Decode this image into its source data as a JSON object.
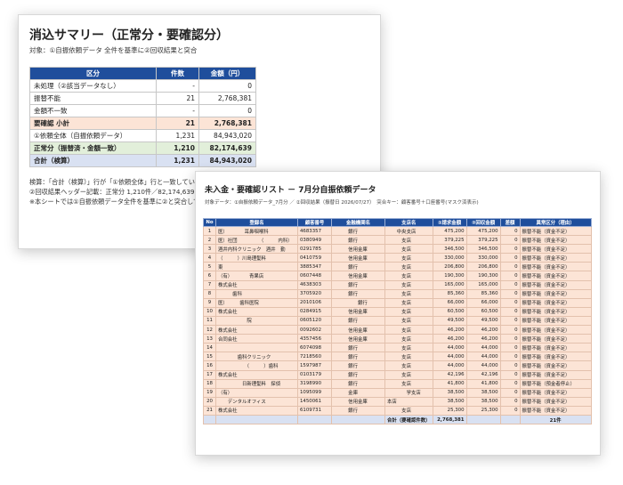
{
  "summary": {
    "title": "消込サマリー（正常分・要確認分）",
    "subtitle": "対象：①自振依頼データ 全件を基準に②回収結果と突合",
    "headers": [
      "区分",
      "件数",
      "金額（円）"
    ],
    "rows": [
      {
        "label": "未処理（②該当データなし）",
        "count": "-",
        "amount": "0"
      },
      {
        "label": "振替不能",
        "count": "21",
        "amount": "2,768,381"
      },
      {
        "label": "金額不一致",
        "count": "-",
        "amount": "0"
      },
      {
        "label": "要確認 小計",
        "count": "21",
        "amount": "2,768,381"
      },
      {
        "label": "①依頼全体（自振依頼データ）",
        "count": "1,231",
        "amount": "84,943,020"
      },
      {
        "label": "正常分（振替済・金額一致）",
        "count": "1,210",
        "amount": "82,174,639"
      },
      {
        "label": "合計（検算）",
        "count": "1,231",
        "amount": "84,943,020"
      }
    ],
    "notes": [
      "検算：「合計（検算）」行が「①依頼全体」行と一致してい",
      "②回収結果ヘッダー記載：正常分 1,210件／82,174,639円",
      "※本シートでは①自振依頼データ全件を基準に②と突合して"
    ]
  },
  "detail": {
    "title": "未入金・要確認リスト － 7月分自振依頼データ",
    "subtitle": "対象データ：①自振依頼データ_7月分 ／ ②回収結果（振替日 2026/07/27）　突合キー：顧客番号＋口座番号(マスク済表示)",
    "headers": [
      "No",
      "登録名",
      "顧客番号",
      "金融機関名",
      "支店名",
      "①請求金額",
      "②回収金額",
      "差額",
      "異常区分（理由）"
    ],
    "rows": [
      {
        "no": "1",
        "name": "医）　　　　耳鼻咽喉科",
        "cust": "4683357",
        "bank": "　　　銀行",
        "branch": "　　中央支店",
        "req": "475,200",
        "rec": "475,200",
        "diff": "0",
        "reason": "振替不能（資金不足）"
      },
      {
        "no": "2",
        "name": "医）社団　　　　　（　　　内科）",
        "cust": "0380949",
        "bank": "　　　銀行",
        "branch": "　　　支店",
        "req": "379,225",
        "rec": "379,225",
        "diff": "0",
        "reason": "振替不能（資金不足）"
      },
      {
        "no": "3",
        "name": "酒井内科クリニック　酒井　勤",
        "cust": "0291785",
        "bank": "　　　信用金庫",
        "branch": "　　　支店",
        "req": "346,500",
        "rec": "346,500",
        "diff": "0",
        "reason": "振替不能（資金不足）"
      },
      {
        "no": "4",
        "name": "（　　　）川島理髪料",
        "cust": "0410759",
        "bank": "　　　信用金庫",
        "branch": "　　　支店",
        "req": "330,000",
        "rec": "330,000",
        "diff": "0",
        "reason": "振替不能（資金不足）"
      },
      {
        "no": "5",
        "name": "東　　　　",
        "cust": "3885347",
        "bank": "　　　銀行",
        "branch": "　　　支店",
        "req": "206,800",
        "rec": "206,800",
        "diff": "0",
        "reason": "振替不能（資金不足）"
      },
      {
        "no": "6",
        "name": "（有）　　　　青果店",
        "cust": "0607448",
        "bank": "　　　信用金庫",
        "branch": "　　　支店",
        "req": "190,300",
        "rec": "190,300",
        "diff": "0",
        "reason": "振替不能（資金不足）"
      },
      {
        "no": "7",
        "name": "株式会社　　　　",
        "cust": "4638303",
        "bank": "　　　銀行",
        "branch": "　　　支店",
        "req": "165,000",
        "rec": "165,000",
        "diff": "0",
        "reason": "振替不能（資金不足）"
      },
      {
        "no": "8",
        "name": "　　　歯科",
        "cust": "3705920",
        "bank": "　　　銀行",
        "branch": "　　　支店",
        "req": "85,360",
        "rec": "85,360",
        "diff": "0",
        "reason": "振替不能（資金不足）"
      },
      {
        "no": "9",
        "name": "医）　　　歯科医院",
        "cust": "2010106",
        "bank": "　　　　　銀行",
        "branch": "　　　支店",
        "req": "66,000",
        "rec": "66,000",
        "diff": "0",
        "reason": "振替不能（資金不足）"
      },
      {
        "no": "10",
        "name": "株式会社　　　　",
        "cust": "0284915",
        "bank": "　　　信用金庫",
        "branch": "　　　支店",
        "req": "60,500",
        "rec": "60,500",
        "diff": "0",
        "reason": "振替不能（資金不足）"
      },
      {
        "no": "11",
        "name": "　　　　　　院",
        "cust": "0605120",
        "bank": "　　　銀行",
        "branch": "　　　支店",
        "req": "49,500",
        "rec": "49,500",
        "diff": "0",
        "reason": "振替不能（資金不足）"
      },
      {
        "no": "12",
        "name": "株式会社　　　　　",
        "cust": "0092602",
        "bank": "　　　信用金庫",
        "branch": "　　　支店",
        "req": "46,200",
        "rec": "46,200",
        "diff": "0",
        "reason": "振替不能（資金不足）"
      },
      {
        "no": "13",
        "name": "合同会社　　　　",
        "cust": "4357456",
        "bank": "　　　信用金庫",
        "branch": "　　　支店",
        "req": "46,200",
        "rec": "46,200",
        "diff": "0",
        "reason": "振替不能（資金不足）"
      },
      {
        "no": "14",
        "name": "　　　　　　",
        "cust": "6074098",
        "bank": "　　　銀行",
        "branch": "　　　支店",
        "req": "44,000",
        "rec": "44,000",
        "diff": "0",
        "reason": "振替不能（資金不足）"
      },
      {
        "no": "15",
        "name": "　　　　歯科クリニック",
        "cust": "7218560",
        "bank": "　　　銀行",
        "branch": "　　　支店",
        "req": "44,000",
        "rec": "44,000",
        "diff": "0",
        "reason": "振替不能（資金不足）"
      },
      {
        "no": "16",
        "name": "　　　　　　（　　　）歯科",
        "cust": "1597987",
        "bank": "　　　銀行",
        "branch": "　　　支店",
        "req": "44,000",
        "rec": "44,000",
        "diff": "0",
        "reason": "振替不能（資金不足）"
      },
      {
        "no": "17",
        "name": "株式会社　　　　",
        "cust": "0103179",
        "bank": "　　　銀行",
        "branch": "　　　支店",
        "req": "42,196",
        "rec": "42,196",
        "diff": "0",
        "reason": "振替不能（資金不足）"
      },
      {
        "no": "18",
        "name": "　　　　　日新理髪料　探偵",
        "cust": "3198990",
        "bank": "　　　銀行",
        "branch": "　　　支店",
        "req": "41,800",
        "rec": "41,800",
        "diff": "0",
        "reason": "振替不能（預金者停止）"
      },
      {
        "no": "19",
        "name": "（有）　　　　",
        "cust": "1095099",
        "bank": "　　　金庫",
        "branch": "　　　　学支店",
        "req": "38,500",
        "rec": "38,500",
        "diff": "0",
        "reason": "振替不能（資金不足）"
      },
      {
        "no": "20",
        "name": "　　デンタルオフィス　　　　",
        "cust": "1450061",
        "bank": "　　　信用金庫",
        "branch": "本店",
        "req": "38,500",
        "rec": "38,500",
        "diff": "0",
        "reason": "振替不能（資金不足）"
      },
      {
        "no": "21",
        "name": "株式会社　　　　　",
        "cust": "6109731",
        "bank": "　　　銀行",
        "branch": "　　　支店",
        "req": "25,300",
        "rec": "25,300",
        "diff": "0",
        "reason": "振替不能（資金不足）"
      }
    ],
    "total": {
      "label": "合計（要確認件数）",
      "amount": "2,768,381",
      "count": "21件"
    }
  }
}
